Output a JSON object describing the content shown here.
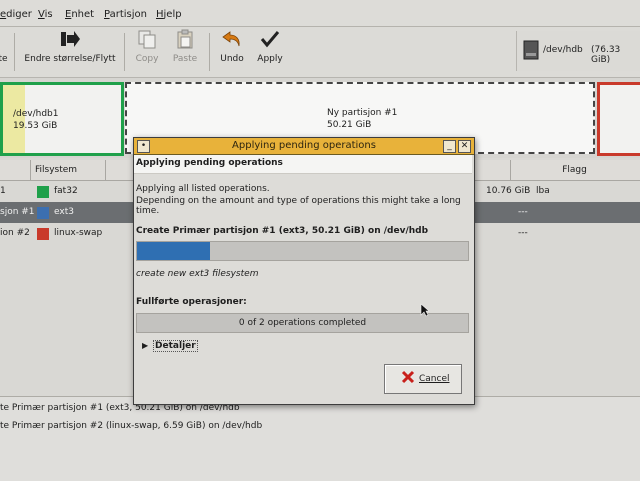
{
  "menubar": {
    "items": [
      "ediger",
      "Vis",
      "Enhet",
      "Partisjon",
      "Hjelp"
    ]
  },
  "toolbar": {
    "partial_left_label": "te",
    "resize_label": "Endre størrelse/Flytt",
    "copy_label": "Copy",
    "paste_label": "Paste",
    "undo_label": "Undo",
    "apply_label": "Apply",
    "device": "/dev/hdb",
    "device_size": "(76.33 GiB)"
  },
  "partitions_view": {
    "hdb1_name": "/dev/hdb1",
    "hdb1_size": "19.53 GiB",
    "new_name": "Ny partisjon #1",
    "new_size": "50.21 GiB"
  },
  "list": {
    "headers": {
      "filesystem": "Filsystem",
      "used_partial": "t",
      "flags": "Flagg"
    },
    "rows": [
      {
        "partition": "1",
        "filesystem": "fat32",
        "used": "10.76 GiB",
        "flags": "lba",
        "color": "#1fa04a"
      },
      {
        "partition": "sjon #1",
        "filesystem": "ext3",
        "used": "---",
        "flags": "",
        "color": "#3c6fb0"
      },
      {
        "partition": "ion #2",
        "filesystem": "linux-swap",
        "used": "---",
        "flags": "",
        "color": "#c93a2b"
      }
    ]
  },
  "operations": {
    "lines": [
      "te Primær partisjon #1 (ext3, 50.21 GiB) on /dev/hdb",
      "te Primær partisjon #2 (linux-swap, 6.59 GiB) on /dev/hdb"
    ]
  },
  "dialog": {
    "title": "Applying pending operations",
    "heading": "Applying pending operations",
    "description_line1": "Applying all listed operations.",
    "description_line2": "Depending on the amount and type of operations this might take a long time.",
    "current_op": "Create Primær partisjon #1 (ext3, 50.21 GiB) on /dev/hdb",
    "current_progress": 0.22,
    "current_status": "create new ext3 filesystem",
    "completed_label": "Fullførte operasjoner:",
    "completed_text": "0 of 2 operations completed",
    "completed_progress": 0,
    "details_label": "Detaljer",
    "cancel_label": "Cancel"
  },
  "colors": {
    "title_bar": "#e8b23a",
    "selection": "#6b6e71",
    "progress": "#2f6fb2"
  },
  "icons": [
    "resize-move-icon",
    "copy-icon",
    "paste-icon",
    "undo-icon",
    "apply-checkmark-icon",
    "harddisk-icon",
    "close-icon",
    "minimize-icon",
    "cancel-x-icon",
    "expander-arrow-icon"
  ]
}
